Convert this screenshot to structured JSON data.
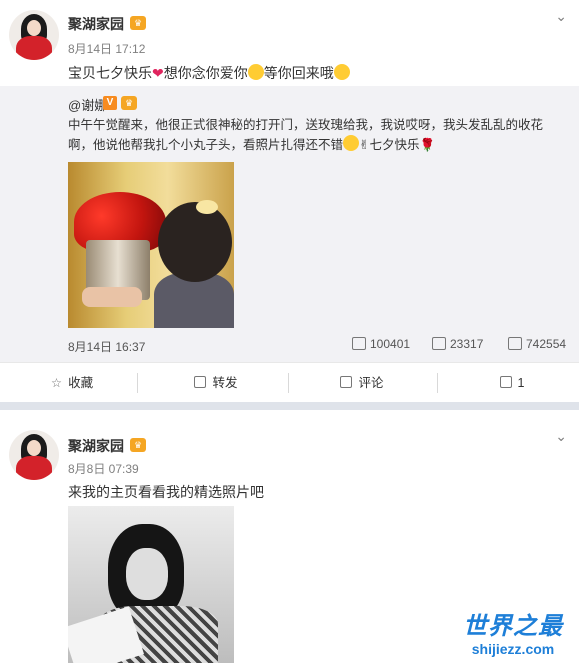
{
  "post1": {
    "author": "聚湖家园",
    "time": "8月14日 17:12",
    "text_a": "宝贝七夕快乐",
    "text_b": "想你念你爱你",
    "text_c": "等你回来哦",
    "repost": {
      "author": "@谢娜",
      "text": "中午午觉醒来，他很正式很神秘的打开门，送玫瑰给我，我说哎呀，我头发乱乱的收花啊，他说他帮我扎个小丸子头，看照片扎得还不错",
      "text_end": "七夕快乐",
      "date": "8月14日 16:37",
      "reposts": "100401",
      "comments": "23317",
      "likes": "742554"
    },
    "actions": {
      "favorite": "收藏",
      "repost": "转发",
      "comment": "评论",
      "like": "1"
    }
  },
  "post2": {
    "author": "聚湖家园",
    "time": "8月8日 07:39",
    "text": "来我的主页看看我的精选照片吧"
  },
  "watermark": {
    "line1": "世界之最",
    "line2": "shijiezz.com"
  },
  "icons": [
    "chevron-down-icon",
    "heart-icon",
    "emoji-icon",
    "v-badge-icon",
    "repost-icon",
    "comment-icon",
    "like-icon",
    "star-icon"
  ]
}
